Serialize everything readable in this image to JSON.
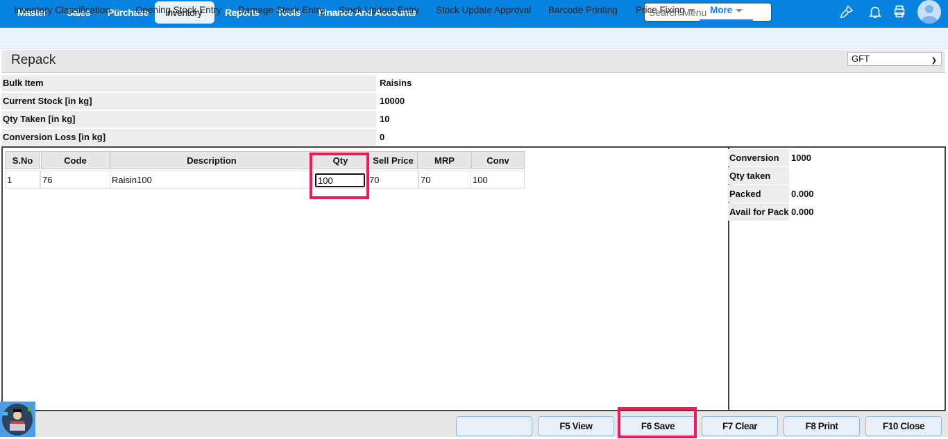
{
  "topnav": {
    "items": [
      "Master",
      "Sales",
      "Purchase",
      "Inventory",
      "Reports",
      "Tools",
      "Finance And Accounts"
    ],
    "active": "Inventory",
    "search_placeholder": "Search Menu"
  },
  "subnav": {
    "items": [
      "Inventory Classification",
      "Opening Stock Entry",
      "Damage Stock Entry",
      "Stock Update Entry",
      "Stock Update Approval",
      "Barcode Printing",
      "Price Fixing"
    ],
    "more": "More"
  },
  "page": {
    "title": "Repack",
    "location_select": "GFT"
  },
  "info": [
    {
      "label": "Bulk Item",
      "value": "Raisins"
    },
    {
      "label": "Current Stock [in kg]",
      "value": "10000"
    },
    {
      "label": "Qty Taken [in kg]",
      "value": "10"
    },
    {
      "label": "Conversion Loss [in kg]",
      "value": "0"
    }
  ],
  "table": {
    "headers": [
      "S.No",
      "Code",
      "Description",
      "Qty",
      "Sell Price",
      "MRP",
      "Conv"
    ],
    "rows": [
      {
        "sno": "1",
        "code": "76",
        "description": "Raisin100",
        "qty": "100",
        "sell_price": "70",
        "mrp": "70",
        "conv": "100"
      }
    ]
  },
  "summary": [
    {
      "label": "Conversion",
      "value": "1000"
    },
    {
      "label": "Qty taken",
      "value": ""
    },
    {
      "label": "Packed",
      "value": "0.000"
    },
    {
      "label": "Avail for Pack",
      "value": "0.000"
    }
  ],
  "buttons": {
    "blank": "",
    "view": "F5 View",
    "save": "F6 Save",
    "clear": "F7 Clear",
    "print": "F8 Print",
    "close": "F10 Close"
  },
  "colors": {
    "topbar": "#0682e1",
    "highlight": "#f0195a"
  }
}
